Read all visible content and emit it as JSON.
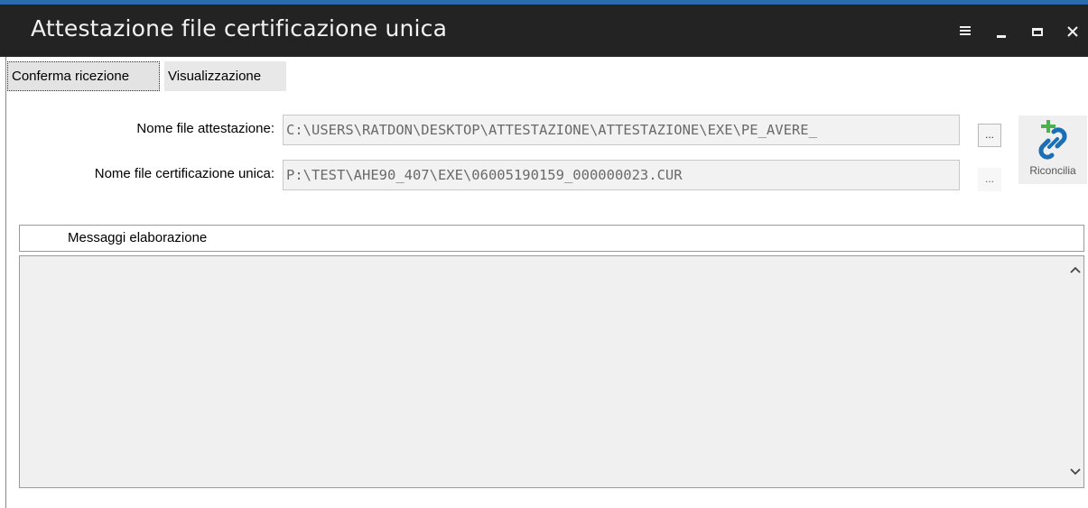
{
  "window": {
    "title": "Attestazione file certificazione unica"
  },
  "tabs": [
    {
      "label": "Conferma ricezione",
      "active": true
    },
    {
      "label": "Visualizzazione",
      "active": false
    }
  ],
  "form": {
    "attestazione": {
      "label": "Nome file attestazione:",
      "value": "C:\\USERS\\RATDON\\DESKTOP\\ATTESTAZIONE\\ATTESTAZIONE\\EXE\\PE_AVERE_"
    },
    "certificazione": {
      "label": "Nome file certificazione unica:",
      "value": "P:\\TEST\\AHE90_407\\EXE\\06005190159_000000023.CUR"
    },
    "browse_label": "...",
    "riconcilia_label": "Riconcilia"
  },
  "messages": {
    "header": "Messaggi elaborazione"
  },
  "colors": {
    "titlebar": "#232323",
    "accent": "#2b6cb0",
    "link_icon": "#1b6fb5",
    "plus_icon": "#4caf50"
  },
  "icons": {
    "menu": "hamburger-icon",
    "minimize": "minimize-icon",
    "maximize": "maximize-icon",
    "close": "close-icon",
    "riconcilia": "link-add-icon",
    "scroll_up": "chevron-up-icon",
    "scroll_down": "chevron-down-icon"
  }
}
